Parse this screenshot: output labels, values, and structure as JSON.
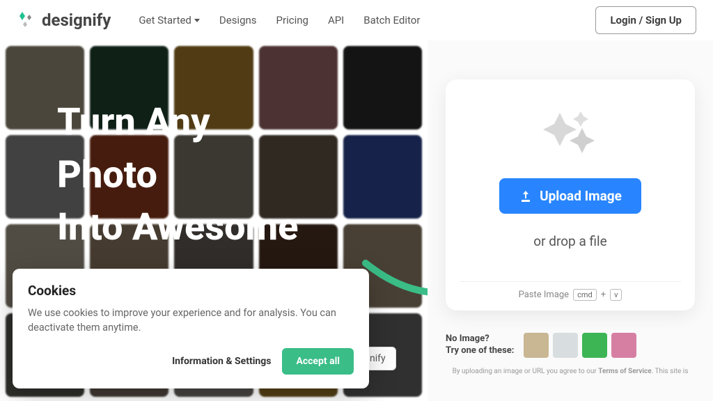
{
  "brand": "designify",
  "nav": {
    "get_started": "Get Started",
    "designs": "Designs",
    "pricing": "Pricing",
    "api": "API",
    "batch": "Batch Editor"
  },
  "login": "Login / Sign Up",
  "headline_l1": "Turn Any",
  "headline_l2": "Photo",
  "headline_l3": "Into Awesome",
  "upload": {
    "button": "Upload Image",
    "drop": "or drop a file",
    "paste_label": "Paste Image",
    "key1": "cmd",
    "plus": "+",
    "key2": "v"
  },
  "try": {
    "line1": "No Image?",
    "line2": "Try one of these:"
  },
  "terms_prefix": "By uploading an image or URL you agree to our ",
  "terms_link": "Terms of Service",
  "terms_suffix": ". This site is",
  "cookie": {
    "title": "Cookies",
    "body": "We use cookies to improve your experience and for analysis. You can deactivate them anytime.",
    "info": "Information & Settings",
    "accept": "Accept all"
  },
  "peek": "nify"
}
